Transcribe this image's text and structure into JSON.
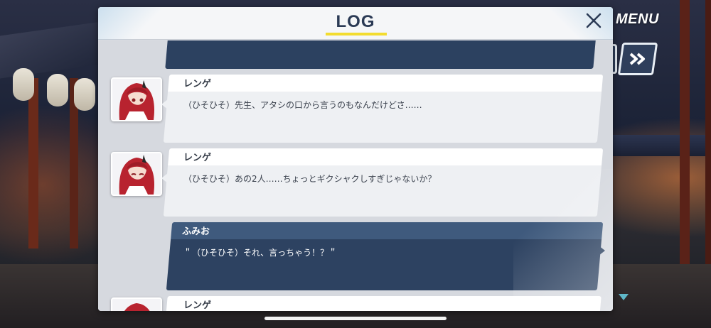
{
  "app": {
    "menu_label": "MENU",
    "fast_forward_icon": "double-chevron-right-icon",
    "scroll_indicator_icon": "triangle-down-icon"
  },
  "log": {
    "title": "LOG",
    "close_icon": "close-icon",
    "entries": [
      {
        "speaker": "レンゲ",
        "text": "（ひそひそ）先生、アタシの口から言うのもなんだけどさ……",
        "style": "other"
      },
      {
        "speaker": "レンゲ",
        "text": "（ひそひそ）あの2人……ちょっとギクシャクしすぎじゃないか？",
        "style": "other"
      },
      {
        "speaker": "ふみお",
        "text": "＂（ひそひそ）それ、言っちゃう！？＂",
        "style": "player"
      },
      {
        "speaker": "レンゲ",
        "text": "",
        "style": "other"
      }
    ]
  },
  "colors": {
    "accent_yellow": "#f3dc2f",
    "panel_navy": "#2d4261",
    "title_navy": "#2b3a55",
    "scroll_arrow": "#5fb7c8"
  }
}
